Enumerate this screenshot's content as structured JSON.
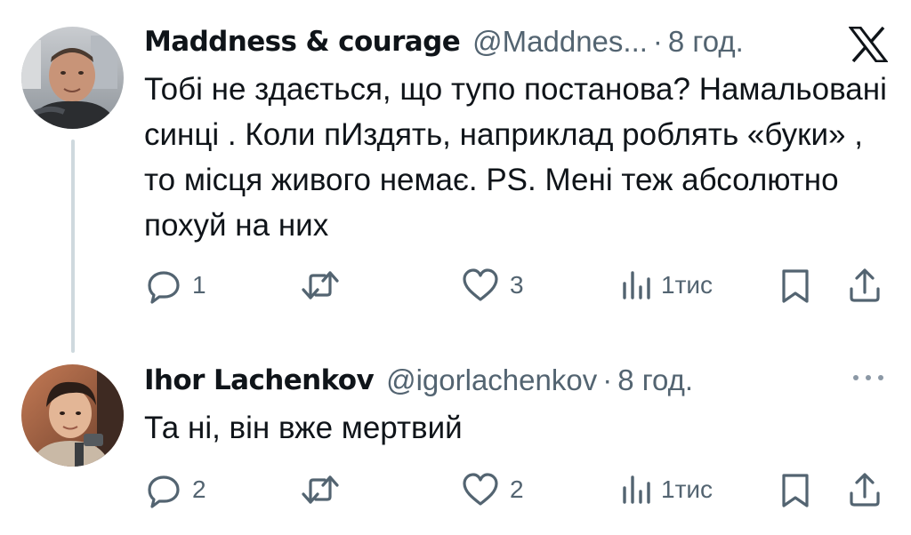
{
  "tweets": [
    {
      "display_name": "Maddness & courage",
      "handle": "@Maddnes...",
      "separator": "·",
      "time": "8 год.",
      "text": "Тобі не здається, що тупо постанова? Намальовані синці . Коли пИздять, наприклад роблять «буки» , то місця живого немає. PS. Мені теж абсолютно похуй на них",
      "counts": {
        "replies": "1",
        "retweets": "",
        "likes": "3",
        "views": "1тис"
      }
    },
    {
      "display_name": "Ihor Lachenkov",
      "handle": "@igorlachenkov",
      "separator": "·",
      "time": "8 год.",
      "text": "Та ні, він вже мертвий",
      "counts": {
        "replies": "2",
        "retweets": "",
        "likes": "2",
        "views": "1тис"
      }
    }
  ],
  "icons": {
    "logo": "x-logo-icon",
    "more": "more-icon",
    "reply": "reply-icon",
    "retweet": "retweet-icon",
    "like": "heart-icon",
    "views": "views-icon",
    "bookmark": "bookmark-icon",
    "share": "share-icon"
  },
  "colors": {
    "text_primary": "#0f1419",
    "text_secondary": "#536471",
    "thread_line": "#cfd9de"
  }
}
